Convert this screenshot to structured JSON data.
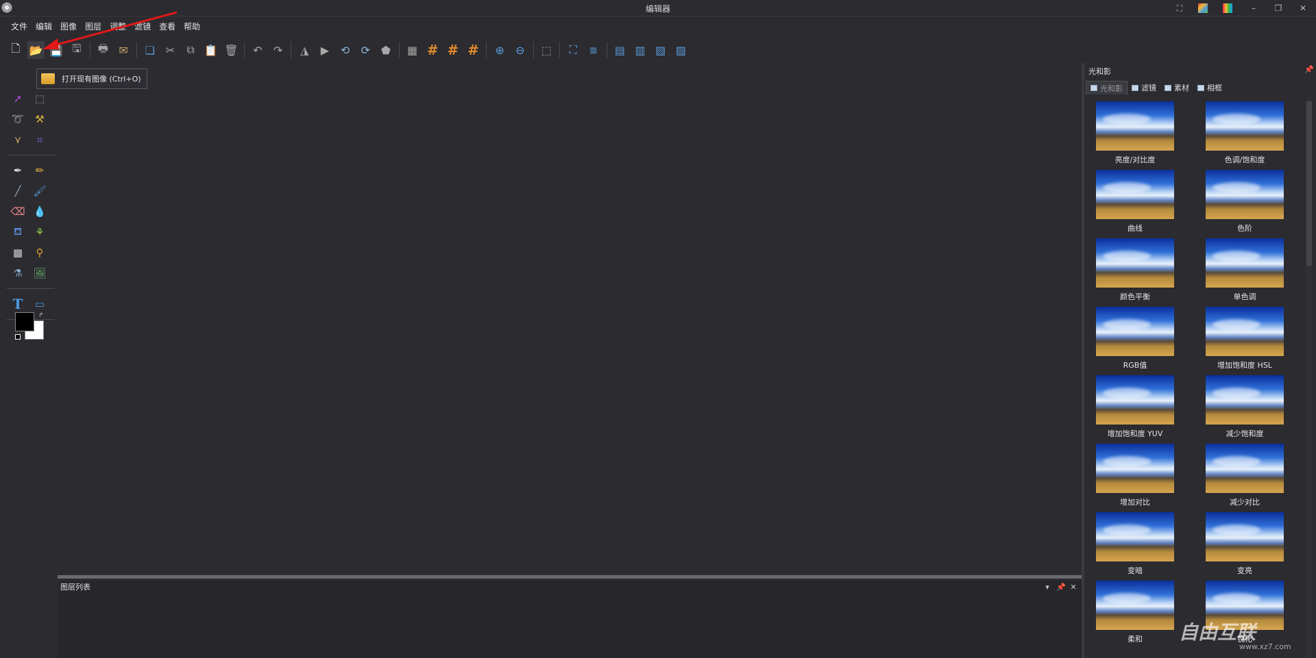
{
  "window": {
    "title": "编辑器"
  },
  "menu": [
    "文件",
    "编辑",
    "图像",
    "图层",
    "调整",
    "滤镜",
    "查看",
    "帮助"
  ],
  "tooltip": {
    "text": "打开现有图像 (Ctrl+O)"
  },
  "layer_panel": {
    "title": "图层列表"
  },
  "right_panel": {
    "title": "光和影",
    "tabs": [
      "光和影",
      "滤镜",
      "素材",
      "相框"
    ],
    "active_tab": 0,
    "effects": [
      "亮度/对比度",
      "色调/饱和度",
      "曲线",
      "色阶",
      "颜色平衡",
      "单色调",
      "RGB值",
      "增加饱和度 HSL",
      "增加饱和度 YUV",
      "减少饱和度",
      "增加对比",
      "减少对比",
      "变暗",
      "变亮",
      "柔和",
      "锐化"
    ]
  },
  "colors": {
    "foreground": "#000000",
    "background": "#ffffff",
    "accent_orange": "#e08a2c",
    "arrow_red": "#e01818"
  },
  "watermark": {
    "text": "自由互联",
    "url": "www.xz7.com"
  }
}
